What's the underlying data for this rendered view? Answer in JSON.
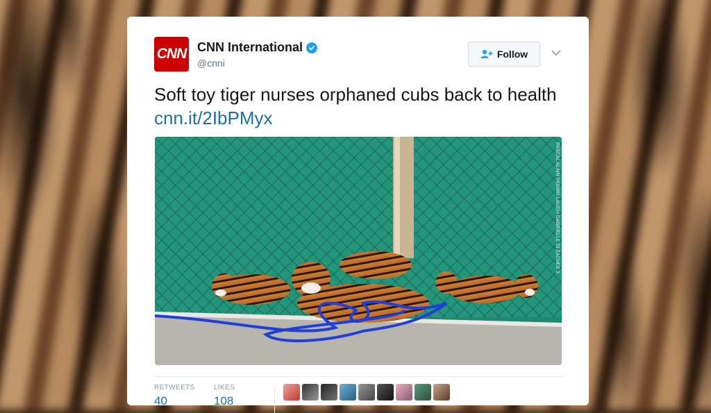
{
  "tweet": {
    "account_name": "CNN International",
    "handle": "@cnni",
    "avatar_text": "CNN",
    "follow_label": "Follow",
    "text": "Soft toy tiger nurses orphaned cubs back to health",
    "link": "cnn.it/2IbPMyx",
    "image_credit": "PASCAL ALAIN YASMIN LAUGH GABRIELLE DI ZACHEE 3",
    "stats": {
      "retweets_label": "RETWEETS",
      "retweets_value": "40",
      "likes_label": "LIKES",
      "likes_value": "108"
    }
  },
  "colors": {
    "brand": "#cc0000",
    "link": "#1b6fa8",
    "verified": "#1da1f2"
  },
  "likers": [
    "liker-1",
    "liker-2",
    "liker-3",
    "liker-4",
    "liker-5",
    "liker-6",
    "liker-7",
    "liker-8",
    "liker-9"
  ]
}
